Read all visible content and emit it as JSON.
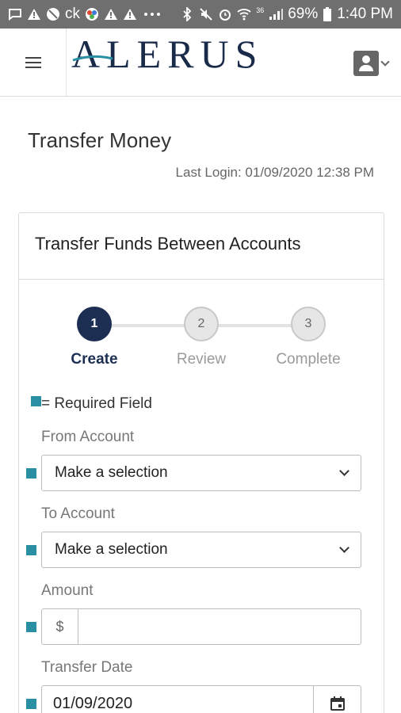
{
  "status_bar": {
    "carrier_text": "ck",
    "battery": "69%",
    "time": "1:40 PM",
    "network_badge": "36",
    "left_icons": [
      "chat-icon",
      "warning-icon",
      "no-sync-icon",
      "nbc-icon",
      "warning-icon",
      "warning-icon",
      "more-icon"
    ],
    "right_icons": [
      "bluetooth-icon",
      "mute-icon",
      "alarm-icon",
      "wifi-icon",
      "signal-icon",
      "battery-icon"
    ]
  },
  "header": {
    "logo_text": "ALERUS",
    "menu_icon": "hamburger-icon",
    "profile_icon": "user-icon"
  },
  "page": {
    "title": "Transfer Money",
    "last_login": "Last Login: 01/09/2020 12:38 PM"
  },
  "card": {
    "title": "Transfer Funds Between Accounts"
  },
  "stepper": {
    "steps": [
      {
        "number": "1",
        "label": "Create",
        "state": "active"
      },
      {
        "number": "2",
        "label": "Review",
        "state": "inactive"
      },
      {
        "number": "3",
        "label": "Complete",
        "state": "inactive"
      }
    ]
  },
  "form": {
    "required_note": "= Required Field",
    "from_account": {
      "label": "From Account",
      "value": "Make a selection"
    },
    "to_account": {
      "label": "To Account",
      "value": "Make a selection"
    },
    "amount": {
      "label": "Amount",
      "prefix": "$",
      "value": ""
    },
    "transfer_date": {
      "label": "Transfer Date",
      "value": "01/09/2020"
    }
  },
  "colors": {
    "brand_navy": "#1c2f52",
    "required_teal": "#2a8fa3",
    "status_bar": "#6f6f6f"
  }
}
